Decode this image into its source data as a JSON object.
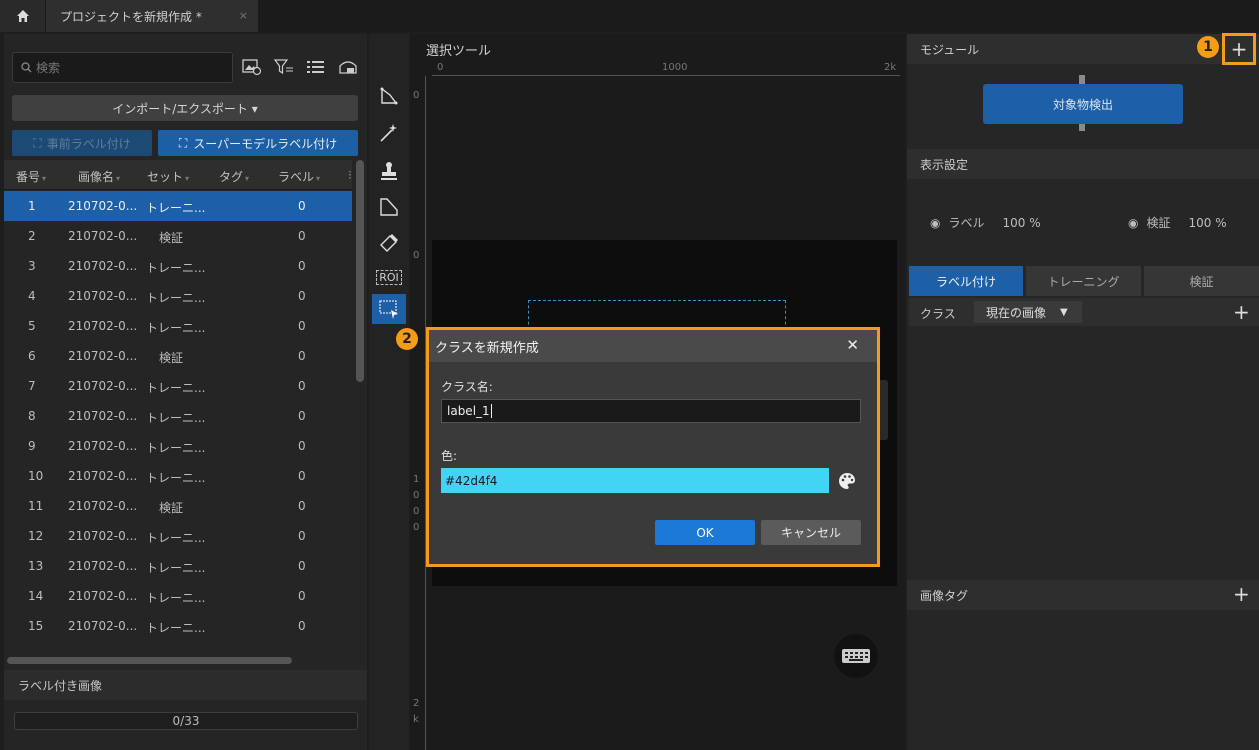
{
  "tab": {
    "title": "プロジェクトを新規作成 *",
    "close": "×"
  },
  "left": {
    "search_placeholder": "検索",
    "import_export": "インポート/エクスポート ▾",
    "pre_label": "事前ラベル付け",
    "super_model_label": "スーパーモデルラベル付け",
    "columns": [
      "番号",
      "画像名",
      "セット",
      "タグ",
      "ラベル",
      "⁝"
    ],
    "rows": [
      {
        "num": "1",
        "name": "210702-0...",
        "set": "トレーニ...",
        "label": "0"
      },
      {
        "num": "2",
        "name": "210702-0...",
        "set": "検証",
        "label": "0"
      },
      {
        "num": "3",
        "name": "210702-0...",
        "set": "トレーニ...",
        "label": "0"
      },
      {
        "num": "4",
        "name": "210702-0...",
        "set": "トレーニ...",
        "label": "0"
      },
      {
        "num": "5",
        "name": "210702-0...",
        "set": "トレーニ...",
        "label": "0"
      },
      {
        "num": "6",
        "name": "210702-0...",
        "set": "検証",
        "label": "0"
      },
      {
        "num": "7",
        "name": "210702-0...",
        "set": "トレーニ...",
        "label": "0"
      },
      {
        "num": "8",
        "name": "210702-0...",
        "set": "トレーニ...",
        "label": "0"
      },
      {
        "num": "9",
        "name": "210702-0...",
        "set": "トレーニ...",
        "label": "0"
      },
      {
        "num": "10",
        "name": "210702-0...",
        "set": "トレーニ...",
        "label": "0"
      },
      {
        "num": "11",
        "name": "210702-0...",
        "set": "検証",
        "label": "0"
      },
      {
        "num": "12",
        "name": "210702-0...",
        "set": "トレーニ...",
        "label": "0"
      },
      {
        "num": "13",
        "name": "210702-0...",
        "set": "トレーニ...",
        "label": "0"
      },
      {
        "num": "14",
        "name": "210702-0...",
        "set": "トレーニ...",
        "label": "0"
      },
      {
        "num": "15",
        "name": "210702-0...",
        "set": "トレーニ...",
        "label": "0"
      }
    ],
    "labeled_images": "ラベル付き画像",
    "progress": "0/33"
  },
  "tools": {
    "roi": "ROI"
  },
  "canvas": {
    "title": "選択ツール",
    "ruler_top": [
      "0",
      "1000",
      "2k"
    ],
    "ruler_left": [
      "0",
      "0",
      "1",
      "0",
      "0",
      "0",
      "2",
      "k"
    ]
  },
  "dialog": {
    "title": "クラスを新規作成",
    "close": "✕",
    "class_name_label": "クラス名:",
    "class_name_value": "label_1",
    "color_label": "色:",
    "color_value": "#42d4f4",
    "ok": "OK",
    "cancel": "キャンセル"
  },
  "badges": {
    "one": "1",
    "two": "2"
  },
  "right": {
    "module_header": "モジュール",
    "add": "+",
    "module_name": "対象物検出",
    "display_header": "表示設定",
    "label_vis": "ラベル",
    "label_pct": "100 %",
    "verify_vis": "検証",
    "verify_pct": "100 %",
    "tabs": [
      "ラベル付け",
      "トレーニング",
      "検証"
    ],
    "class_label": "クラス",
    "class_select": "現在の画像",
    "image_tag_header": "画像タグ"
  },
  "colors": {
    "accent": "#1d60a8",
    "highlight": "#f39c1a",
    "class_color": "#42d4f4"
  }
}
